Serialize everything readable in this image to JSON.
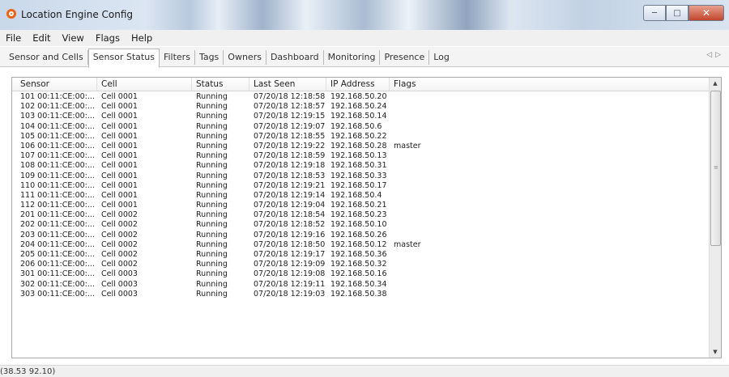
{
  "window": {
    "title": "Location Engine Config"
  },
  "menu": [
    "File",
    "Edit",
    "View",
    "Flags",
    "Help"
  ],
  "tabs": [
    {
      "label": "Sensor and Cells",
      "active": false
    },
    {
      "label": "Sensor Status",
      "active": true
    },
    {
      "label": "Filters",
      "active": false
    },
    {
      "label": "Tags",
      "active": false
    },
    {
      "label": "Owners",
      "active": false
    },
    {
      "label": "Dashboard",
      "active": false
    },
    {
      "label": "Monitoring",
      "active": false
    },
    {
      "label": "Presence",
      "active": false
    },
    {
      "label": "Log",
      "active": false
    }
  ],
  "table": {
    "columns": [
      "Sensor",
      "Cell",
      "Status",
      "Last Seen",
      "IP Address",
      "Flags"
    ],
    "rows": [
      [
        "101 00:11:CE:00:...",
        "Cell 0001",
        "Running",
        "07/20/18 12:18:58",
        "192.168.50.20",
        ""
      ],
      [
        "102 00:11:CE:00:...",
        "Cell 0001",
        "Running",
        "07/20/18 12:18:57",
        "192.168.50.24",
        ""
      ],
      [
        "103 00:11:CE:00:...",
        "Cell 0001",
        "Running",
        "07/20/18 12:19:15",
        "192.168.50.14",
        ""
      ],
      [
        "104 00:11:CE:00:...",
        "Cell 0001",
        "Running",
        "07/20/18 12:19:07",
        "192.168.50.6",
        ""
      ],
      [
        "105 00:11:CE:00:...",
        "Cell 0001",
        "Running",
        "07/20/18 12:18:55",
        "192.168.50.22",
        ""
      ],
      [
        "106 00:11:CE:00:...",
        "Cell 0001",
        "Running",
        "07/20/18 12:19:22",
        "192.168.50.28",
        "master"
      ],
      [
        "107 00:11:CE:00:...",
        "Cell 0001",
        "Running",
        "07/20/18 12:18:59",
        "192.168.50.13",
        ""
      ],
      [
        "108 00:11:CE:00:...",
        "Cell 0001",
        "Running",
        "07/20/18 12:19:18",
        "192.168.50.31",
        ""
      ],
      [
        "109 00:11:CE:00:...",
        "Cell 0001",
        "Running",
        "07/20/18 12:18:53",
        "192.168.50.33",
        ""
      ],
      [
        "110 00:11:CE:00:...",
        "Cell 0001",
        "Running",
        "07/20/18 12:19:21",
        "192.168.50.17",
        ""
      ],
      [
        "111 00:11:CE:00:...",
        "Cell 0001",
        "Running",
        "07/20/18 12:19:14",
        "192.168.50.4",
        ""
      ],
      [
        "112 00:11:CE:00:...",
        "Cell 0001",
        "Running",
        "07/20/18 12:19:04",
        "192.168.50.21",
        ""
      ],
      [
        "201 00:11:CE:00:...",
        "Cell 0002",
        "Running",
        "07/20/18 12:18:54",
        "192.168.50.23",
        ""
      ],
      [
        "202 00:11:CE:00:...",
        "Cell 0002",
        "Running",
        "07/20/18 12:18:52",
        "192.168.50.10",
        ""
      ],
      [
        "203 00:11:CE:00:...",
        "Cell 0002",
        "Running",
        "07/20/18 12:19:16",
        "192.168.50.26",
        ""
      ],
      [
        "204 00:11:CE:00:...",
        "Cell 0002",
        "Running",
        "07/20/18 12:18:50",
        "192.168.50.12",
        "master"
      ],
      [
        "205 00:11:CE:00:...",
        "Cell 0002",
        "Running",
        "07/20/18 12:19:17",
        "192.168.50.36",
        ""
      ],
      [
        "206 00:11:CE:00:...",
        "Cell 0002",
        "Running",
        "07/20/18 12:19:09",
        "192.168.50.32",
        ""
      ],
      [
        "301 00:11:CE:00:...",
        "Cell 0003",
        "Running",
        "07/20/18 12:19:08",
        "192.168.50.16",
        ""
      ],
      [
        "302 00:11:CE:00:...",
        "Cell 0003",
        "Running",
        "07/20/18 12:19:11",
        "192.168.50.34",
        ""
      ],
      [
        "303 00:11:CE:00:...",
        "Cell 0003",
        "Running",
        "07/20/18 12:19:03",
        "192.168.50.38",
        ""
      ]
    ]
  },
  "status_bar": {
    "text": "(38.53 92.10)"
  },
  "icons": {
    "app": "app-icon",
    "minimize": "minimize-icon",
    "maximize": "maximize-icon",
    "close": "close-icon",
    "tab_scroll": "tab-scroll-arrows-icon",
    "scroll_up": "scroll-up-arrow-icon",
    "scroll_down": "scroll-down-arrow-icon"
  },
  "colors": {
    "close_button": "#c2452c",
    "app_icon": "#e8641b"
  }
}
